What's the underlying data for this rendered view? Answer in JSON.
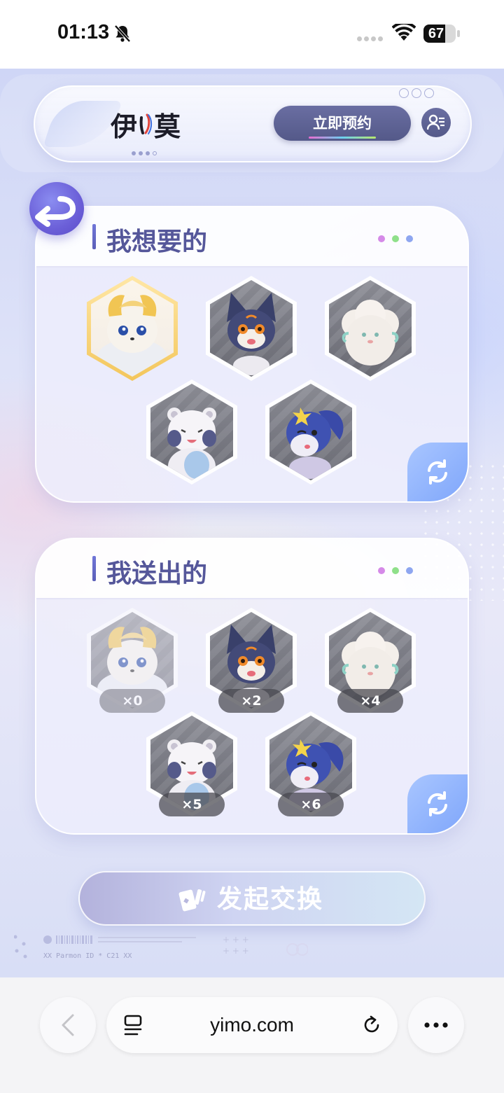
{
  "status_bar": {
    "time": "01:13",
    "battery_level": 67,
    "battery_text": "67"
  },
  "header": {
    "logo_text": "伊)莫",
    "reserve_label": "立即预约"
  },
  "want_section": {
    "title": "我想要的",
    "dot_colors": [
      "#d58ae8",
      "#8fe08a",
      "#8ea6f0"
    ],
    "items": [
      {
        "name": "yellow-cloud-fox",
        "selected": true
      },
      {
        "name": "navy-fox"
      },
      {
        "name": "fluffy-sheep"
      },
      {
        "name": "white-bear"
      },
      {
        "name": "blue-star-squirrel"
      }
    ]
  },
  "give_section": {
    "title": "我送出的",
    "dot_colors": [
      "#d58ae8",
      "#8fe08a",
      "#8ea6f0"
    ],
    "items": [
      {
        "name": "yellow-cloud-fox",
        "count": "×0",
        "faded": true
      },
      {
        "name": "navy-fox",
        "count": "×2"
      },
      {
        "name": "fluffy-sheep",
        "count": "×4"
      },
      {
        "name": "white-bear",
        "count": "×5"
      },
      {
        "name": "blue-star-squirrel",
        "count": "×6"
      }
    ]
  },
  "exchange_label": "发起交换",
  "footer_id": "XX Parmon ID * C21 XX",
  "browser": {
    "url": "yimo.com"
  },
  "colors": {
    "accent": "#5b5fb8",
    "button": "#545989",
    "refresh": "#7fa6fb"
  }
}
